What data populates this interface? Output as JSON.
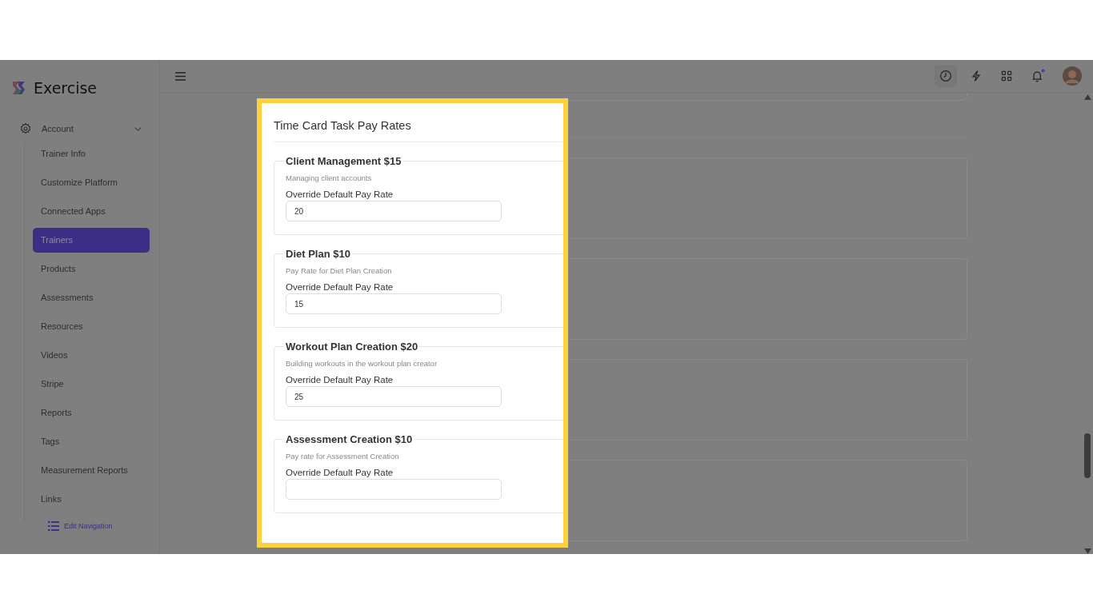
{
  "brand": {
    "name": "Exercise"
  },
  "sidebar": {
    "group": {
      "label": "Account",
      "expanded": true
    },
    "items": [
      {
        "label": "Trainer Info",
        "selected": false
      },
      {
        "label": "Customize Platform",
        "selected": false
      },
      {
        "label": "Connected Apps",
        "selected": false
      },
      {
        "label": "Trainers",
        "selected": true
      },
      {
        "label": "Products",
        "selected": false
      },
      {
        "label": "Assessments",
        "selected": false
      },
      {
        "label": "Resources",
        "selected": false
      },
      {
        "label": "Videos",
        "selected": false
      },
      {
        "label": "Stripe",
        "selected": false
      },
      {
        "label": "Reports",
        "selected": false
      },
      {
        "label": "Tags",
        "selected": false
      },
      {
        "label": "Measurement Reports",
        "selected": false
      },
      {
        "label": "Links",
        "selected": false
      }
    ],
    "edit_link": "Edit Navigation"
  },
  "panel": {
    "title": "Time Card Task Pay Rates",
    "tasks": [
      {
        "title": "Client Management $15",
        "description": "Managing client accounts",
        "field_label": "Override Default Pay Rate",
        "value": "20"
      },
      {
        "title": "Diet Plan $10",
        "description": "Pay Rate for Diet Plan Creation",
        "field_label": "Override Default Pay Rate",
        "value": "15"
      },
      {
        "title": "Workout Plan Creation $20",
        "description": "Building workouts in the workout plan creator",
        "field_label": "Override Default Pay Rate",
        "value": "25"
      },
      {
        "title": "Assessment Creation $10",
        "description": "Pay rate for Assessment Creation",
        "field_label": "Override Default Pay Rate"
      }
    ]
  }
}
